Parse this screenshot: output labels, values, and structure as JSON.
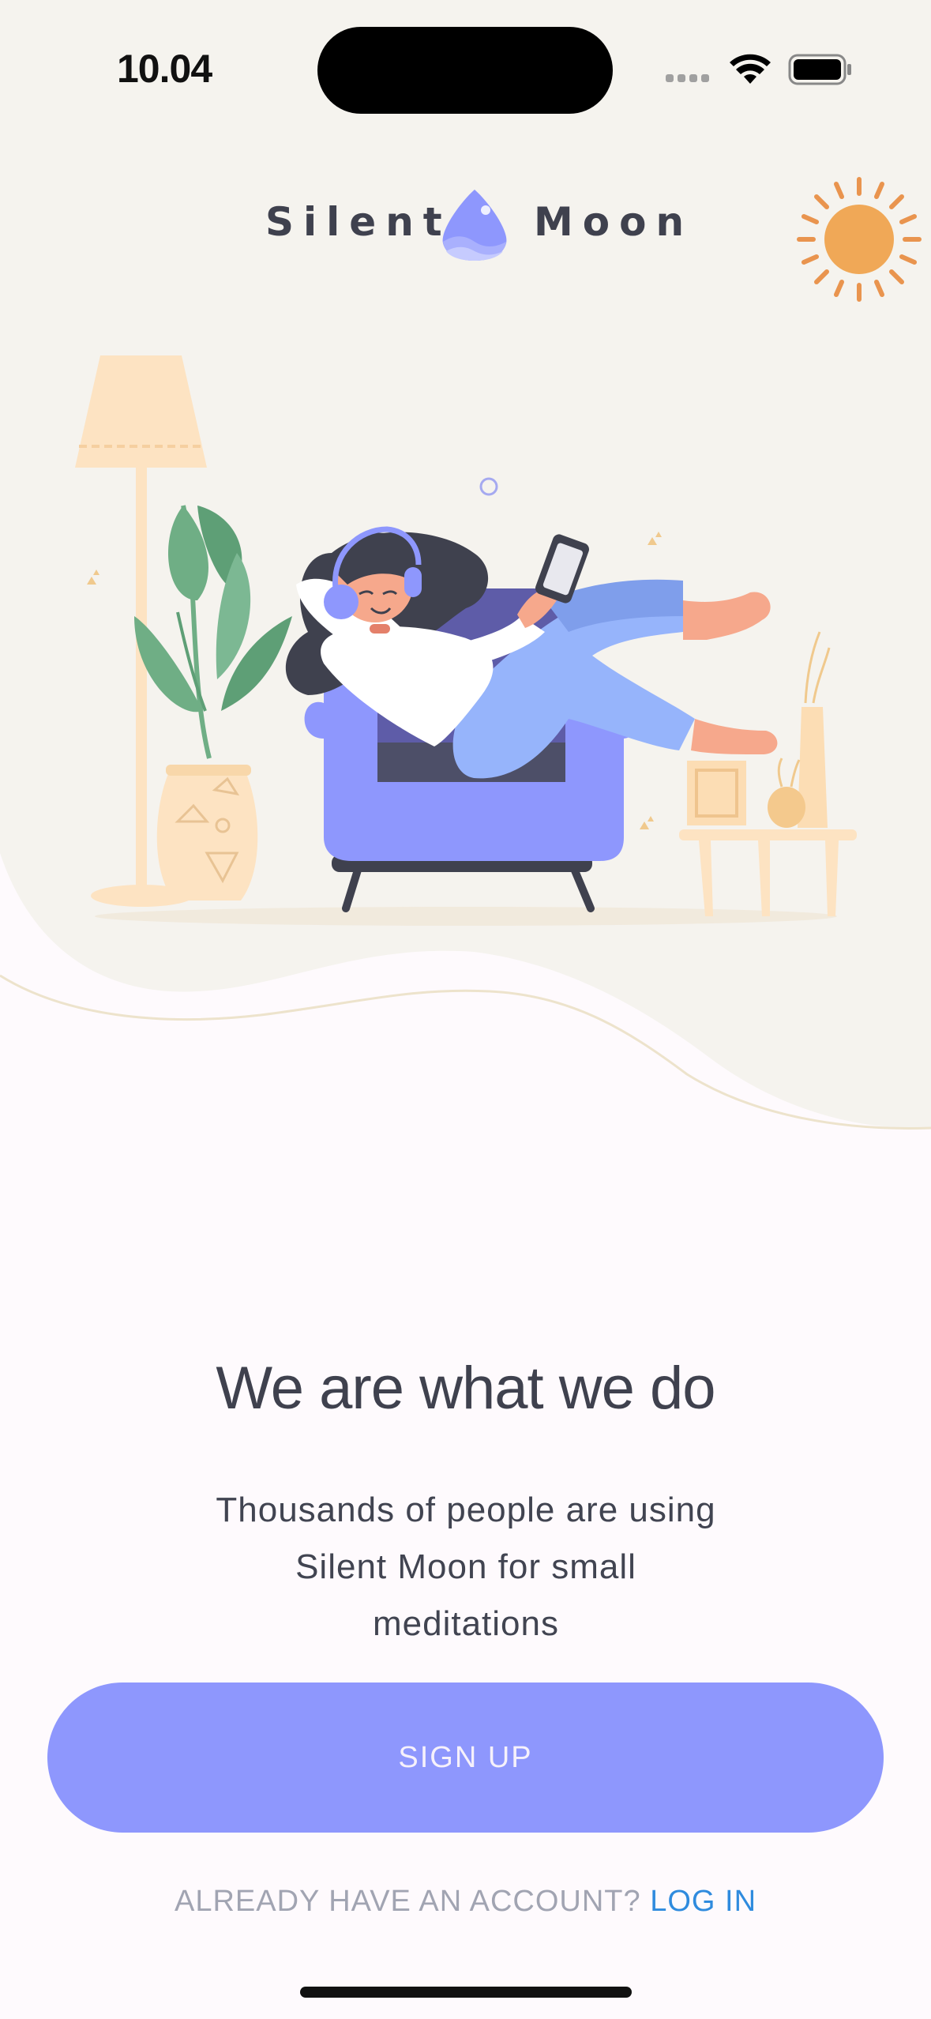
{
  "status_bar": {
    "time": "10.04"
  },
  "brand": {
    "name_left": "Silent",
    "name_right": "Moon",
    "logo_icon": "moon-drop-icon"
  },
  "hero": {
    "illustration": "woman-relaxing-in-armchair-illustration",
    "sun_icon": "sun-icon"
  },
  "headline": "We are what we do",
  "subtitle": {
    "lines": [
      "Thousands of people are using",
      "Silent Moon for small",
      "meditations"
    ]
  },
  "signup_button": {
    "label": "SIGN UP"
  },
  "login": {
    "prompt": "ALREADY HAVE AN ACCOUNT?",
    "link": "LOG IN"
  },
  "colors": {
    "background": "#FEFAFD",
    "hero_background": "#F5F3EE",
    "accent": "#8E97FD",
    "link": "#2F8BDE",
    "text_dark": "#3F414E",
    "text_muted": "#A1A4B2"
  }
}
